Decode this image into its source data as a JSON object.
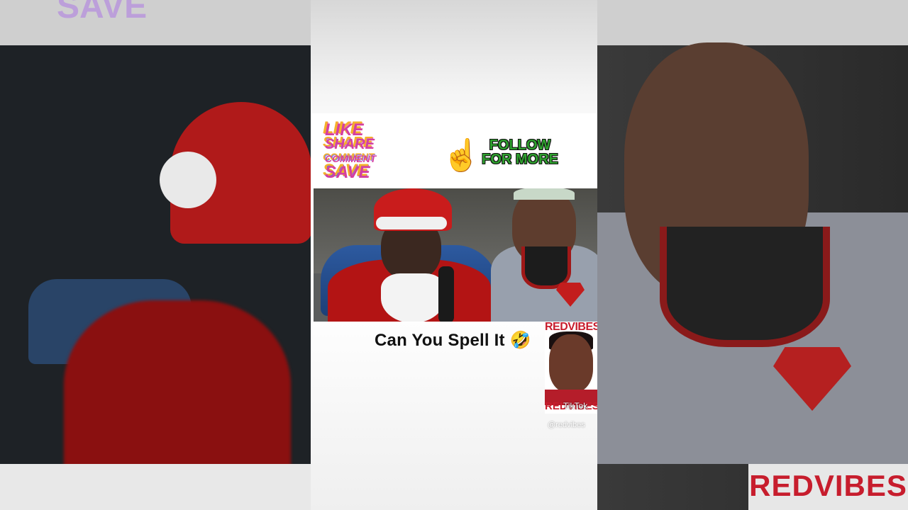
{
  "banner": {
    "like": "LIKE",
    "share": "SHARE",
    "comment": "COMMENT",
    "save": "SAVE",
    "follow_line1": "FOLLOW",
    "follow_line2": "FOR MORE",
    "pointing_emoji": "☝️"
  },
  "caption": "Can You Spell It 🤣",
  "watermark": {
    "logo_top": "REDVIBES",
    "logo_bottom": "REDVIBES",
    "tiktok": "TikTok",
    "handle": "@redvibes"
  },
  "background": {
    "right_logo": "REDVIBES",
    "top_left_text": "SAVE"
  }
}
